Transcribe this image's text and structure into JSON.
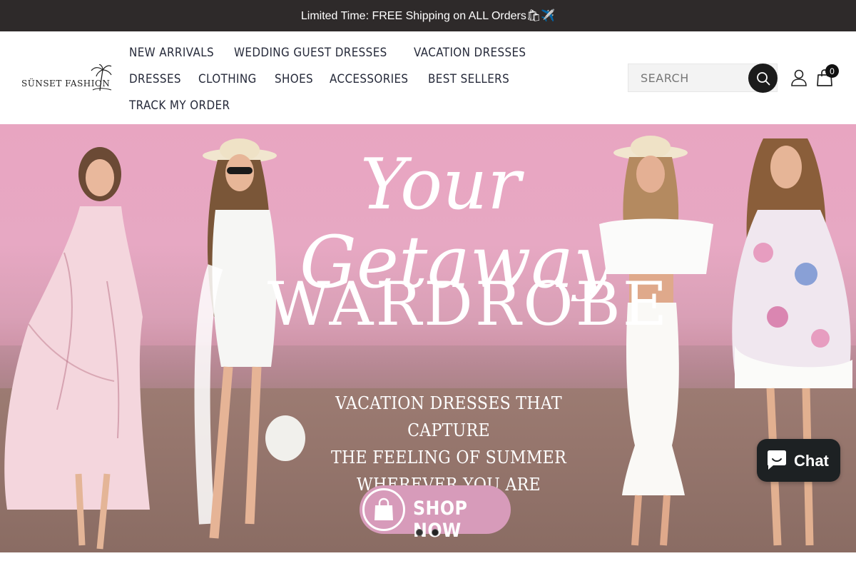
{
  "announcement": {
    "text": "Limited Time: FREE Shipping on ALL Orders🛍✈️"
  },
  "brand": {
    "logo_text": "SÜNSET FASHION"
  },
  "nav": {
    "items": [
      {
        "label": "NEW ARRIVALS"
      },
      {
        "label": "WEDDING GUEST DRESSES"
      },
      {
        "label": "VACATION DRESSES"
      },
      {
        "label": "DRESSES"
      },
      {
        "label": "CLOTHING"
      },
      {
        "label": "SHOES"
      },
      {
        "label": "ACCESSORIES"
      },
      {
        "label": "BEST SELLERS"
      },
      {
        "label": "TRACK MY ORDER"
      }
    ]
  },
  "search": {
    "placeholder": "SEARCH",
    "value": ""
  },
  "cart": {
    "count": "0"
  },
  "hero": {
    "script_title": "Your Getaway",
    "title": "WARDROBE",
    "tagline_lines": [
      "VACATION DRESSES THAT CAPTURE",
      "THE FEELING OF SUMMER",
      "WHEREVER YOU ARE"
    ],
    "cta_label": "SHOP NOW",
    "slides": 2,
    "active_slide": 2
  },
  "chat": {
    "label": "Chat"
  },
  "colors": {
    "announcement_bg": "#2e2a2a",
    "nav_text": "#262a3a",
    "cta_pink": "#d79bba",
    "chat_bg": "#1d2123"
  },
  "icons": [
    "search-icon",
    "user-icon",
    "shopping-bag-icon",
    "chat-bubble-icon",
    "palm-tree-icon"
  ]
}
